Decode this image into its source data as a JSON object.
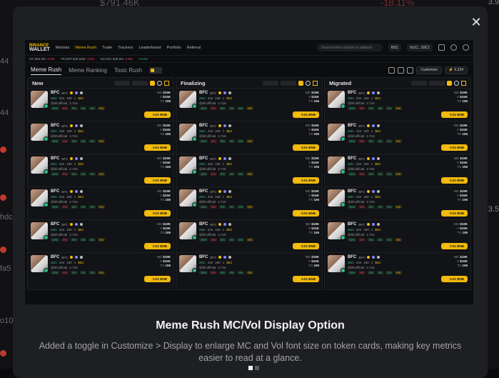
{
  "background": {
    "price_left": "$791.46K",
    "price_right": "-18.11%",
    "right_values": [
      "3.9",
      "3.5"
    ],
    "left_values": [
      "44",
      "44",
      "hdc",
      "fa5",
      "o10"
    ]
  },
  "modal": {
    "headline": "Meme Rush MC/Vol Display Option",
    "description": "Added a toggle in Customize > Display to enlarge MC and Vol font size on token cards, making key metrics easier to read at a glance.",
    "close_icon": "close-icon",
    "pager": {
      "count": 2,
      "active": 0
    }
  },
  "screenshot": {
    "brand": {
      "top": "BINANCE",
      "bottom": "WALLET"
    },
    "nav": [
      "Markets",
      "Meme Rush",
      "Trade",
      "Trackers",
      "Leaderboard",
      "Portfolio",
      "Referral"
    ],
    "nav_active": 1,
    "search_placeholder": "Search token symbol or address",
    "chain": "BSC",
    "wallet": "0x1C...59C1",
    "ticker": [
      {
        "label": "CR",
        "value": "$96.6M",
        "change": "-2.4%",
        "dir": "r"
      },
      {
        "label": "TRUMP",
        "value": "$48.58M",
        "change": "-4.2%",
        "dir": "r"
      },
      {
        "label": "NCUSD",
        "value": "$48.8M",
        "change": "-1.8%",
        "dir": "r"
      },
      {
        "label": "",
        "value": "",
        "change": "+3.2%",
        "dir": "g"
      }
    ],
    "tabs": [
      "Meme Rush",
      "Meme Ranking",
      "Toxic Rush"
    ],
    "tab_active": 0,
    "customize_label": "Customize",
    "balance": "0.234",
    "columns": [
      {
        "title": "New"
      },
      {
        "title": "Finalizing"
      },
      {
        "title": "Migrated"
      }
    ],
    "card": {
      "symbol": "BFC",
      "name": "BFC",
      "age": "25m",
      "handle": "@bfcofficial",
      "holders": "2.71K",
      "mc_label": "MC",
      "mc_value": "$19K",
      "vol_label": "V",
      "vol_value": "$15K",
      "tx_label": "TX",
      "tx_value": "106",
      "stat_a": "234",
      "stat_b": "180",
      "stat_c": "1",
      "stat_d": "$53",
      "tags": [
        "15%",
        "0%",
        "5%",
        "4%",
        "3%",
        "0%"
      ],
      "buy_label": "0.01 BNB"
    },
    "card_count": 6
  }
}
